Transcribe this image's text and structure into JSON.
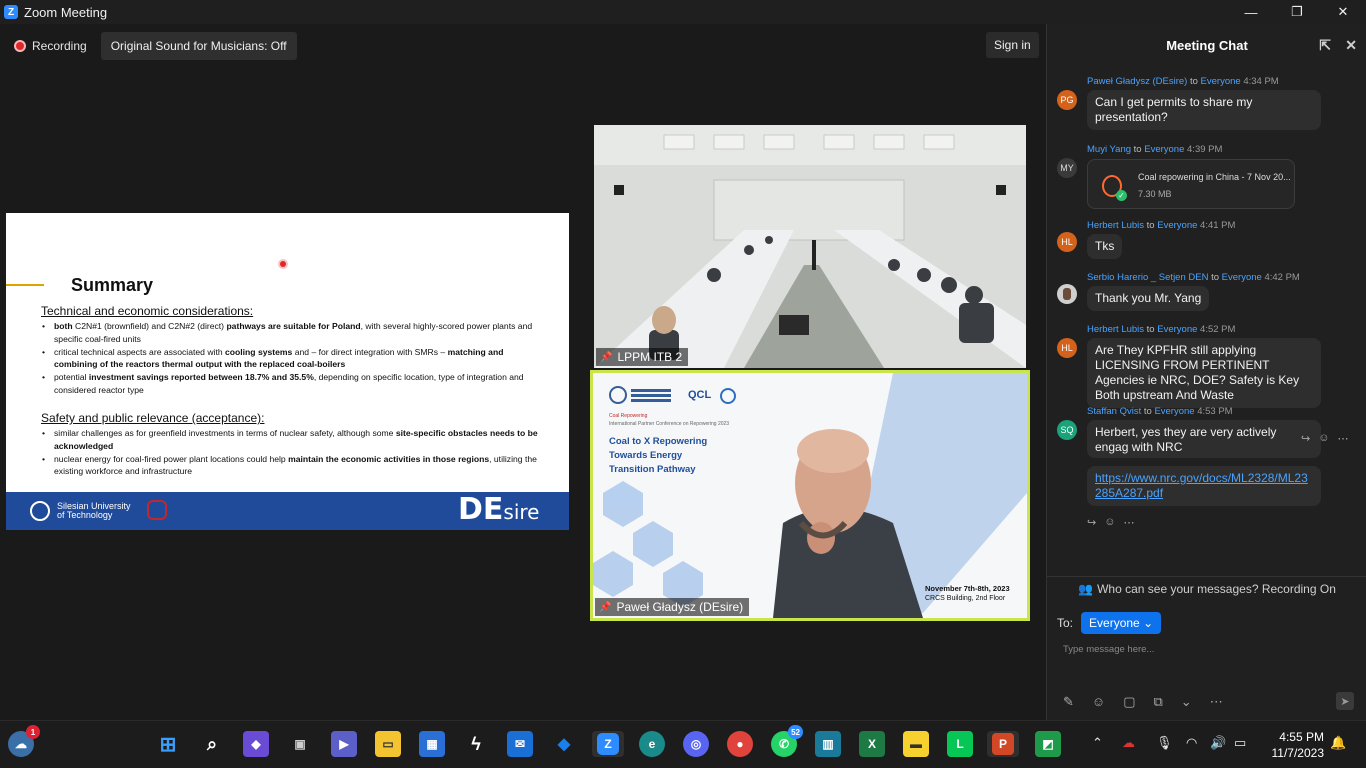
{
  "window": {
    "title": "Zoom Meeting",
    "minimize": "—",
    "restore": "❐",
    "close": "✕"
  },
  "toolbar": {
    "recording_label": "Recording",
    "original_sound": "Original Sound for Musicians: Off",
    "sign_in": "Sign in"
  },
  "slide": {
    "title": "Summary",
    "section1": "Technical and economic considerations:",
    "bullets1": [
      {
        "pre": "",
        "b1": "both",
        "mid": " C2N#1 (brownfield) and C2N#2 (direct) ",
        "b2": "pathways are suitable for Poland",
        "post": ", with several highly-scored power plants and specific coal-fired units"
      },
      {
        "pre": "critical technical aspects are associated with ",
        "b1": "cooling systems",
        "mid": " and – for direct integration with SMRs – ",
        "b2": "matching and combining of the reactors thermal output with the replaced coal-boilers",
        "post": ""
      },
      {
        "pre": "potential ",
        "b1": "investment savings reported between 18.7% and 35.5%",
        "mid": ", depending on specific location, type of integration and considered reactor type",
        "b2": "",
        "post": ""
      }
    ],
    "section2": "Safety and public relevance (acceptance):",
    "bullets2": [
      {
        "pre": "similar challenges as for greenfield investments in terms of nuclear safety, although some ",
        "b1": "site-specific obstacles needs to be acknowledged",
        "mid": "",
        "b2": "",
        "post": ""
      },
      {
        "pre": "nuclear energy for coal-fired power plant locations could help ",
        "b1": "maintain the economic activities in those regions",
        "mid": ", utilizing the existing workforce and infrastructure",
        "b2": "",
        "post": ""
      }
    ],
    "university": "Silesian University\nof Technology",
    "brand_main": "DE",
    "brand_sub": "sire"
  },
  "tiles": [
    {
      "name": "LPPM ITB 2"
    },
    {
      "name": "Paweł Gładysz (DEsire)"
    }
  ],
  "tile2_banner": {
    "org": "QCL",
    "kicker": "Coal Repowering",
    "conf": "International Partner Conference on Repowering 2023",
    "title": "Coal to X Repowering\nTowards Energy\nTransition Pathway",
    "date": "November 7th-8th, 2023",
    "venue": "CRCS Building, 2nd Floor"
  },
  "chat": {
    "title": "Meeting Chat",
    "messages": [
      {
        "initials": "PG",
        "color": "#d4621b",
        "sender": "Paweł Gładysz (DEsire)",
        "to": "to",
        "recipient": "Everyone",
        "time": "4:34 PM",
        "text": "Can I get permits to share my presentation?"
      },
      {
        "initials": "MY",
        "color": "#3a3a3a",
        "sender": "Muyi Yang",
        "to": "to",
        "recipient": "Everyone",
        "time": "4:39 PM",
        "file_name": "Coal repowering in China - 7 Nov 20...",
        "file_size": "7.30 MB"
      },
      {
        "initials": "HL",
        "color": "#d4621b",
        "sender": "Herbert Lubis",
        "to": "to",
        "recipient": "Everyone",
        "time": "4:41 PM",
        "text": "Tks"
      },
      {
        "initials": "",
        "color": "#cfcfcf",
        "sender": "Serbio Harerio _ Setjen DEN",
        "to": "to",
        "recipient": "Everyone",
        "time": "4:42 PM",
        "text": "Thank you Mr. Yang"
      },
      {
        "initials": "HL",
        "color": "#d4621b",
        "sender": "Herbert Lubis",
        "to": "to",
        "recipient": "Everyone",
        "time": "4:52 PM",
        "text": "Are They KPFHR still applying LICENSING FROM PERTINENT Agencies ie NRC, DOE? Safety is Key Both upstream And Waste"
      },
      {
        "initials": "SQ",
        "color": "#1aa37a",
        "sender": "Staffan Qvist",
        "to": "to",
        "recipient": "Everyone",
        "time": "4:53 PM",
        "text": "Herbert, yes they are very actively engag with NRC",
        "link": "https://www.nrc.gov/docs/ML2328/ML23285A287.pdf"
      }
    ],
    "visibility": "Who can see your messages? Recording On",
    "to_label": "To:",
    "to_value": "Everyone",
    "placeholder": "Type message here..."
  },
  "taskbar": {
    "apps": [
      "Windows Start",
      "Search",
      "Copilot",
      "Task View",
      "Teams",
      "File Explorer",
      "Microsoft Store",
      "App",
      "Mail",
      "Dropbox",
      "Zoom",
      "Edge",
      "Discord",
      "Chrome",
      "WhatsApp",
      "App",
      "Excel",
      "Sticky Notes",
      "LINE",
      "PowerPoint",
      "App"
    ],
    "whatsapp_badge": "52",
    "weather_badge": "1",
    "time": "4:55 PM",
    "date": "11/7/2023"
  }
}
